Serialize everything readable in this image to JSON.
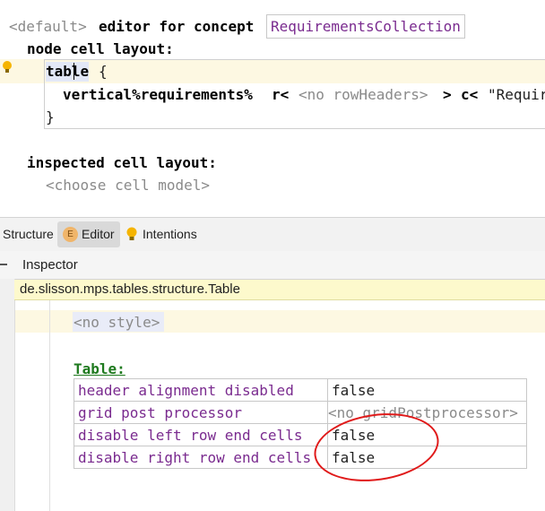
{
  "editor": {
    "header_prefix": "<default>",
    "header_mid": "editor for concept",
    "concept_name": "RequirementsCollection",
    "node_cell_layout_label": "node cell layout:",
    "table_keyword": "table",
    "open_brace": "{",
    "row_prefix": "vertical%requirements%",
    "row_r": "r<",
    "row_placeholder": "<no rowHeaders>",
    "row_gt": ">",
    "row_c": "c<",
    "row_tail": "\"Requir",
    "close_brace": "}",
    "inspected_label": "inspected cell layout:",
    "choose_model": "<choose cell model>"
  },
  "tool_tabs": [
    {
      "label": "Structure",
      "icon": ""
    },
    {
      "label": "Editor",
      "icon": "E"
    },
    {
      "label": "Intentions",
      "icon": "lightbulb-icon"
    }
  ],
  "inspector": {
    "title": "Inspector",
    "node_path": "de.slisson.mps.tables.structure.Table",
    "no_style": "<no style>",
    "section_label": "Table:",
    "properties": [
      {
        "key": "header alignment disabled",
        "value": "false"
      },
      {
        "key": "grid post processor",
        "value": "<no gridPostprocessor>"
      },
      {
        "key": "disable left row end cells",
        "value": "false"
      },
      {
        "key": "disable right row end cells",
        "value": "false"
      }
    ]
  },
  "colors": {
    "accent": "#7a2b8f",
    "annotation": "#e01a1a",
    "node_bar": "#fdf9cc"
  }
}
